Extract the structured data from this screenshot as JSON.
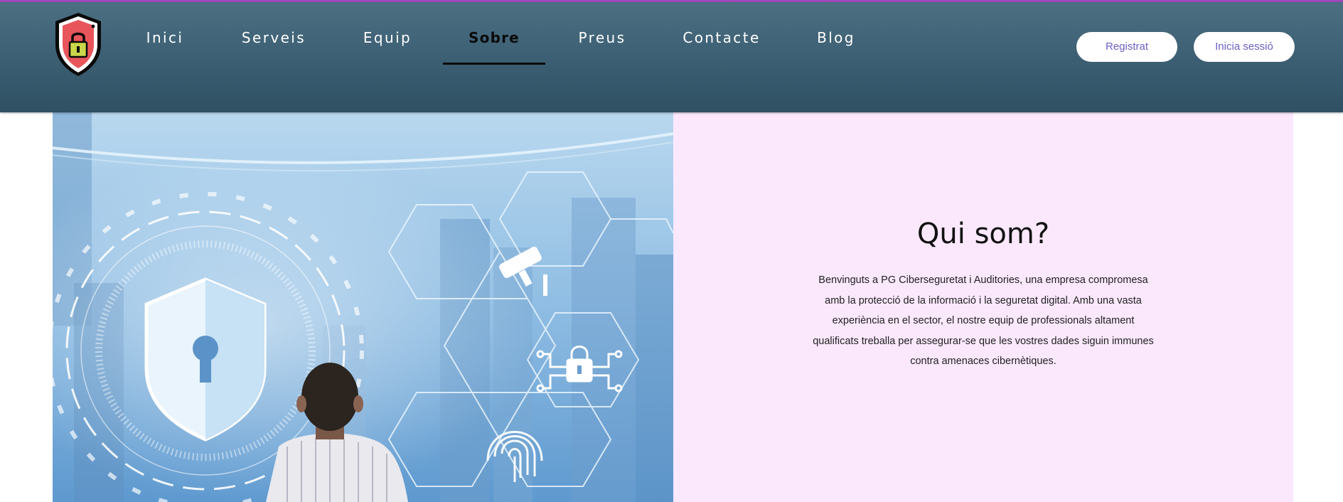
{
  "header": {
    "nav": [
      {
        "label": "Inici",
        "active": false
      },
      {
        "label": "Serveis",
        "active": false
      },
      {
        "label": "Equip",
        "active": false
      },
      {
        "label": "Sobre",
        "active": true
      },
      {
        "label": "Preus",
        "active": false
      },
      {
        "label": "Contacte",
        "active": false
      },
      {
        "label": "Blog",
        "active": false
      }
    ],
    "register_label": "Registrat",
    "login_label": "Inicia sessió"
  },
  "about": {
    "title": "Qui som?",
    "body": "Benvinguts a PG Ciberseguretat i Auditories, una empresa compromesa amb la protecció de la informació i la seguretat digital. Amb una vasta experiència en el sector, el nostre equip de professionals altament qualificats treballa per assegurar-se que les vostres dades siguin immunes contra amenaces cibernètiques."
  },
  "icons": {
    "logo": "shield-lock-icon",
    "hero": [
      "security-shield-icon",
      "keyhole-icon",
      "security-camera-icon",
      "circuit-lock-icon",
      "fingerprint-icon"
    ]
  },
  "colors": {
    "header_top": "#4c6f82",
    "header_bottom": "#2f5063",
    "accent_line": "#a24bbf",
    "panel_bg": "#fbe8fd",
    "button_text": "#6a5fc4"
  }
}
